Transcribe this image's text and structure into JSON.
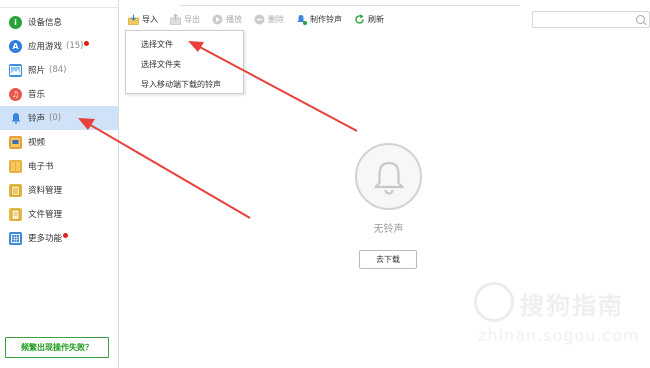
{
  "sidebar": {
    "items": [
      {
        "label": "设备信息",
        "count": "",
        "icon": "info-icon",
        "color": "#2aa23a"
      },
      {
        "label": "应用游戏",
        "count": "(15)",
        "icon": "appstore-icon",
        "color": "#2f7de1"
      },
      {
        "label": "照片",
        "count": "(84)",
        "icon": "photo-icon",
        "color": "#3b8fe0"
      },
      {
        "label": "音乐",
        "count": "",
        "icon": "music-icon",
        "color": "#e8594b"
      },
      {
        "label": "铃声",
        "count": "(0)",
        "icon": "bell-icon",
        "color": "#3a86de"
      },
      {
        "label": "视频",
        "count": "",
        "icon": "video-icon",
        "color": "#e6a23a"
      },
      {
        "label": "电子书",
        "count": "",
        "icon": "ebook-icon",
        "color": "#e8b23e"
      },
      {
        "label": "资料管理",
        "count": "",
        "icon": "contacts-icon",
        "color": "#e0b640"
      },
      {
        "label": "文件管理",
        "count": "",
        "icon": "file-icon",
        "color": "#e6b94a"
      },
      {
        "label": "更多功能",
        "count": "",
        "icon": "more-icon",
        "color": "#3e8ad8"
      }
    ],
    "feedback_label": "频繁出现操作失败？"
  },
  "toolbar": {
    "import": "导入",
    "export": "导出",
    "play": "播放",
    "delete": "删除",
    "make_ringtone": "制作铃声",
    "refresh": "刷新"
  },
  "import_menu": {
    "items": [
      "选择文件",
      "选择文件夹",
      "导入移动端下载的铃声"
    ]
  },
  "empty_state": {
    "text": "无铃声",
    "download_label": "去下载"
  },
  "watermark": {
    "title": "搜狗指南",
    "url": "zhinan.sogou.com"
  },
  "colors": {
    "active_bg": "#cfe2f8",
    "arrow": "#e8403a",
    "badge": "#e0201b"
  }
}
